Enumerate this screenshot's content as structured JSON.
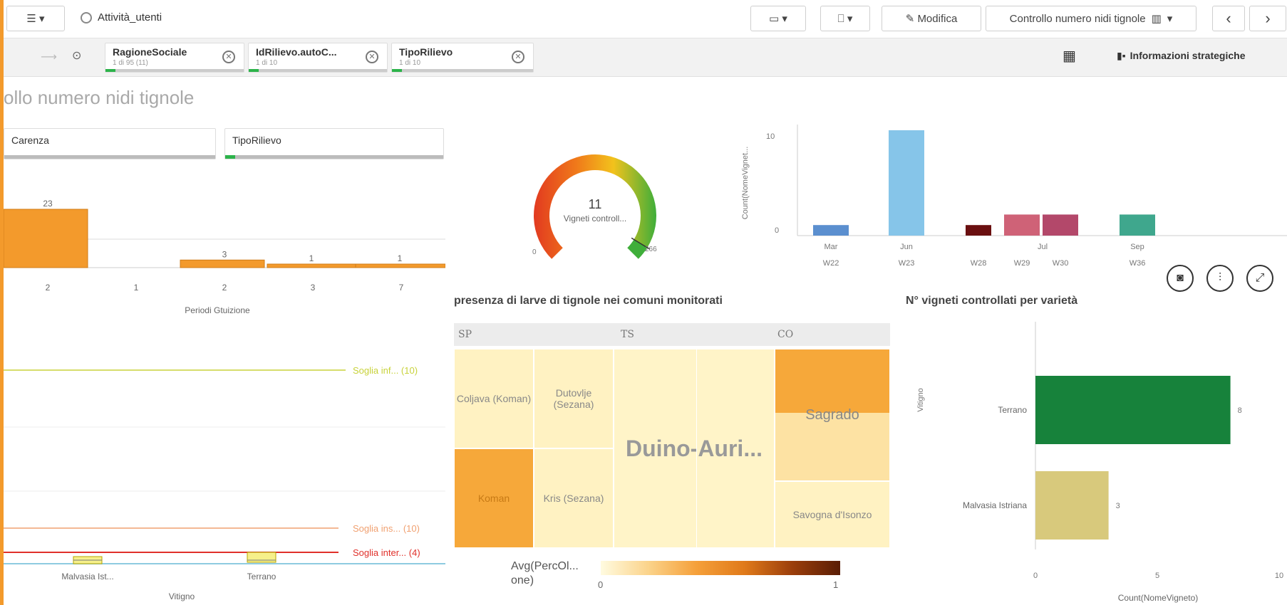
{
  "toolbar": {
    "app_name": "Attività_utenti",
    "edit_label": "Modifica",
    "sheet_selector": "Controllo numero nidi tignole"
  },
  "filters": [
    {
      "title": "RagioneSociale",
      "sub": "1 di 95 (11)"
    },
    {
      "title": "IdRilievo.autoC...",
      "sub": "1 di 10"
    },
    {
      "title": "TipoRilievo",
      "sub": "1 di 10"
    }
  ],
  "insights_label": "Informazioni strategiche",
  "sheet_title": "ollo numero nidi tignole",
  "filterboxes": {
    "left": "Carenza",
    "right": "TipoRilievo"
  },
  "bar_left": {
    "chart_data": {
      "type": "bar",
      "categories": [
        "2",
        "1",
        "2",
        "3",
        "7"
      ],
      "values": [
        23,
        null,
        3,
        1,
        1
      ],
      "labels": [
        "23",
        "",
        "3",
        "1",
        "1"
      ],
      "xlabel": "Periodi Gtuizione"
    }
  },
  "gauge": {
    "value": "11",
    "label": "Vigneti controll...",
    "min": "0",
    "max": "266",
    "fraction": 0.95
  },
  "bar_weekly": {
    "chart_data": {
      "type": "bar",
      "ylabel": "Count(NomeVignet...",
      "yticks": [
        "10",
        "0"
      ],
      "ylim": [
        0,
        10
      ],
      "months": [
        "Mar",
        "Jun",
        "Jul",
        "Sep"
      ],
      "weeks": [
        "W22",
        "W23",
        "W28",
        "W29",
        "W30",
        "W36"
      ],
      "values": [
        1,
        10,
        1,
        2,
        2,
        2
      ],
      "colors": [
        "#5b8fcf",
        "#86c5e9",
        "#6a0f10",
        "#cf6277",
        "#b3486a",
        "#3fa78d"
      ]
    }
  },
  "action_icons": [
    "camera-icon",
    "sliders-icon",
    "expand-icon"
  ],
  "treemap": {
    "title": "presenza di larve di tignole nei comuni monitorati",
    "groups": [
      "SP",
      "TS",
      "CO"
    ],
    "cells": [
      "Coljava (Koman)",
      "Dutovlje (Sezana)",
      "Koman",
      "Kris (Sezana)",
      "Duino-Auri...",
      "Sagrado",
      "Savogna d'Isonzo"
    ],
    "legend_label": "Avg(PercOl... one)",
    "legend_min": "0",
    "legend_max": "1"
  },
  "hbar": {
    "title": "N° vigneti controllati per varietà",
    "chart_data": {
      "type": "bar",
      "orientation": "horizontal",
      "categories": [
        "Terrano",
        "Malvasia Istriana"
      ],
      "values": [
        8,
        3
      ],
      "colors": [
        "#17823b",
        "#d8c97c"
      ],
      "ylabel": "Vitigno",
      "xlabel": "Count(NomeVigneto)",
      "xticks": [
        "0",
        "5",
        "10"
      ],
      "xlim": [
        0,
        10
      ]
    }
  },
  "boxplot": {
    "categories": [
      "Malvasia Ist...",
      "Terrano"
    ],
    "xlabel": "Vitigno",
    "ref_lines": [
      {
        "label": "Soglia inf... (10)",
        "color": "#c8d23a"
      },
      {
        "label": "Soglia ins... (10)",
        "color": "#f0a070"
      },
      {
        "label": "Soglia inter... (4)",
        "color": "#e0302a"
      }
    ]
  }
}
